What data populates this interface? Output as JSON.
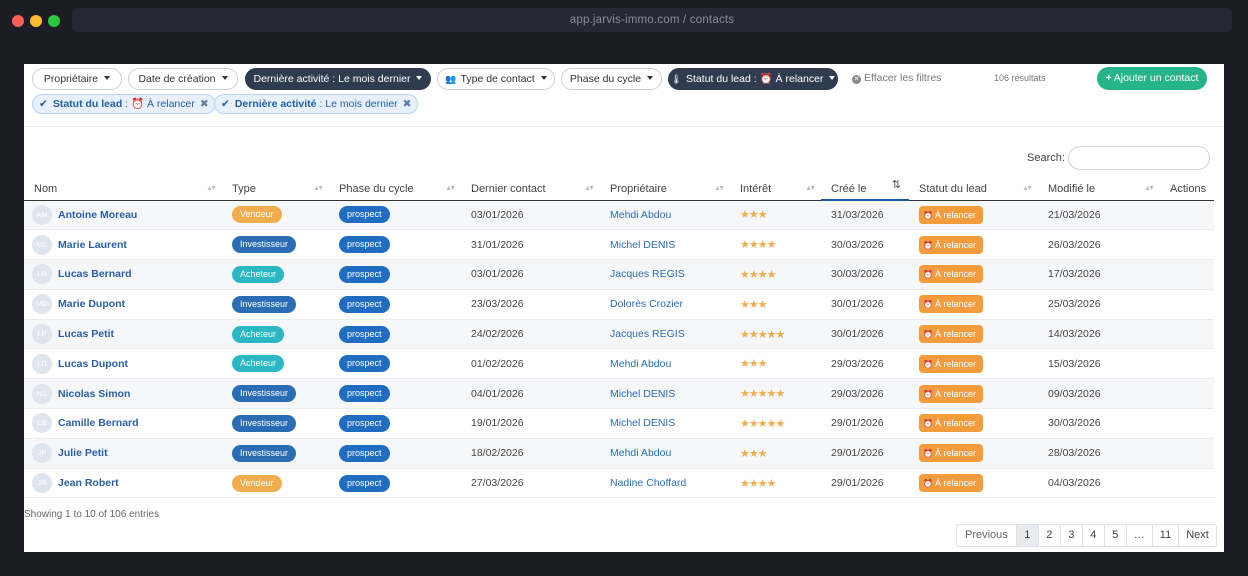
{
  "window": {
    "url": "app.jarvis-immo.com / contacts"
  },
  "filters": {
    "proprietaire": "Propriétaire",
    "date_creation": "Date de création",
    "derniere_activite": "Dernière activité : Le mois dernier",
    "type_contact": "Type de contact",
    "phase_cycle": "Phase du cycle",
    "statut_lead": "Statut du lead : ⏰ À relancer",
    "clear": "Effacer les filtres",
    "results": "106 résultats",
    "add_contact": "Ajouter un contact"
  },
  "chips": [
    {
      "label": "Statut du lead",
      "value": ": ⏰ À relancer"
    },
    {
      "label": "Dernière activité",
      "value": ": Le mois dernier"
    }
  ],
  "search": {
    "label": "Search:",
    "placeholder": ""
  },
  "table": {
    "headers": [
      "Nom",
      "Type",
      "Phase du cycle",
      "Dernier contact",
      "Propriétaire",
      "Intérêt",
      "Créé le",
      "Statut du lead",
      "Modifié le",
      "Actions"
    ],
    "rows": [
      {
        "initials": "AM",
        "name": "Antoine Moreau",
        "type": "Vendeur",
        "phase": "prospect",
        "last_contact": "03/01/2026",
        "owner": "Mehdi Abdou",
        "stars": "★★★",
        "created": "31/03/2026",
        "status": "À relancer",
        "modified": "21/03/2026"
      },
      {
        "initials": "ML",
        "name": "Marie Laurent",
        "type": "Investisseur",
        "phase": "prospect",
        "last_contact": "31/01/2026",
        "owner": "Michel DENIS",
        "stars": "★★★★",
        "created": "30/03/2026",
        "status": "À relancer",
        "modified": "26/03/2026"
      },
      {
        "initials": "LB",
        "name": "Lucas Bernard",
        "type": "Acheteur",
        "phase": "prospect",
        "last_contact": "03/01/2026",
        "owner": "Jacques REGIS",
        "stars": "★★★★",
        "created": "30/03/2026",
        "status": "À relancer",
        "modified": "17/03/2026"
      },
      {
        "initials": "MD",
        "name": "Marie Dupont",
        "type": "Investisseur",
        "phase": "prospect",
        "last_contact": "23/03/2026",
        "owner": "Dolorès Crozier",
        "stars": "★★★",
        "created": "30/01/2026",
        "status": "À relancer",
        "modified": "25/03/2026"
      },
      {
        "initials": "LP",
        "name": "Lucas Petit",
        "type": "Acheteur",
        "phase": "prospect",
        "last_contact": "24/02/2026",
        "owner": "Jacques REGIS",
        "stars": "★★★★★",
        "created": "30/01/2026",
        "status": "À relancer",
        "modified": "14/03/2026"
      },
      {
        "initials": "LD",
        "name": "Lucas Dupont",
        "type": "Acheteur",
        "phase": "prospect",
        "last_contact": "01/02/2026",
        "owner": "Mehdi Abdou",
        "stars": "★★★",
        "created": "29/03/2026",
        "status": "À relancer",
        "modified": "15/03/2026"
      },
      {
        "initials": "NS",
        "name": "Nicolas Simon",
        "type": "Investisseur",
        "phase": "prospect",
        "last_contact": "04/01/2026",
        "owner": "Michel DENIS",
        "stars": "★★★★★",
        "created": "29/03/2026",
        "status": "À relancer",
        "modified": "09/03/2026"
      },
      {
        "initials": "CB",
        "name": "Camille Bernard",
        "type": "Investisseur",
        "phase": "prospect",
        "last_contact": "19/01/2026",
        "owner": "Michel DENIS",
        "stars": "★★★★★",
        "created": "29/01/2026",
        "status": "À relancer",
        "modified": "30/03/2026"
      },
      {
        "initials": "JP",
        "name": "Julie Petit",
        "type": "Investisseur",
        "phase": "prospect",
        "last_contact": "18/02/2026",
        "owner": "Mehdi Abdou",
        "stars": "★★★",
        "created": "29/01/2026",
        "status": "À relancer",
        "modified": "28/03/2026"
      },
      {
        "initials": "JR",
        "name": "Jean Robert",
        "type": "Vendeur",
        "phase": "prospect",
        "last_contact": "27/03/2026",
        "owner": "Nadine Choffard",
        "stars": "★★★★",
        "created": "29/01/2026",
        "status": "À relancer",
        "modified": "04/03/2026"
      }
    ]
  },
  "footer": {
    "showing": "Showing 1 to 10 of 106 entries",
    "pages": [
      "Previous",
      "1",
      "2",
      "3",
      "4",
      "5",
      "…",
      "11",
      "Next"
    ]
  },
  "colors": {
    "accent": "#2a6db5",
    "add_button": "#26b58a",
    "status": "#f39c3d",
    "dark_filter": "#2f3c4f"
  }
}
